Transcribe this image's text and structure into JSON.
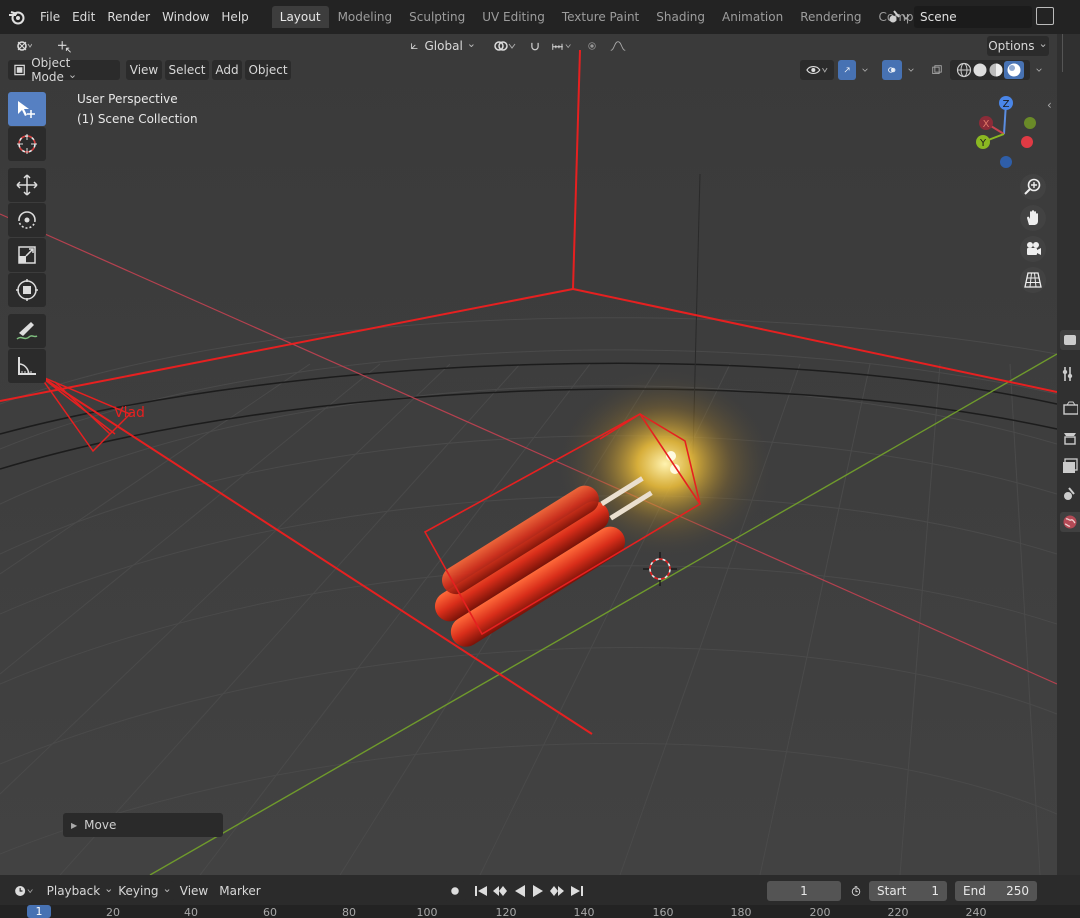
{
  "topbar": {
    "menus": [
      "File",
      "Edit",
      "Render",
      "Window",
      "Help"
    ],
    "workspaces": [
      "Layout",
      "Modeling",
      "Sculpting",
      "UV Editing",
      "Texture Paint",
      "Shading",
      "Animation",
      "Rendering",
      "Compositing"
    ],
    "active_workspace": "Layout",
    "scene_name": "Scene"
  },
  "viewport": {
    "transform_orientation": "Global",
    "options_label": "Options",
    "mode": "Object Mode",
    "menus": [
      "View",
      "Select",
      "Add",
      "Object"
    ],
    "perspective_label": "User Perspective",
    "collection_label": "(1) Scene Collection",
    "camera_label": "Vlad",
    "last_operator": "Move",
    "gizmo_axes": {
      "z": "Z",
      "x": "X",
      "y": "Y"
    }
  },
  "colors": {
    "selection": "#e62020",
    "active_tab": "#3d3d3d",
    "accent": "#4772b3",
    "grid_bg": "#3c3c3c",
    "x_axis": "#b5414f",
    "y_axis": "#6f9a2c"
  },
  "timeline": {
    "menus": [
      "Playback",
      "Keying",
      "View",
      "Marker"
    ],
    "current_frame": "1",
    "start_label": "Start",
    "start_value": "1",
    "end_label": "End",
    "end_value": "250",
    "ruler_current": "1",
    "ruler_ticks": [
      "20",
      "40",
      "60",
      "80",
      "100",
      "120",
      "140",
      "160",
      "180",
      "200",
      "220",
      "240"
    ]
  },
  "icons": {
    "logo": "blender-logo-icon",
    "toolbar": [
      "select-box-icon",
      "cursor-icon",
      "move-icon",
      "rotate-icon",
      "scale-icon",
      "transform-icon",
      "annotate-icon",
      "measure-icon"
    ],
    "nav": [
      "zoom-icon",
      "hand-pan-icon",
      "camera-view-icon",
      "ortho-grid-icon"
    ]
  }
}
